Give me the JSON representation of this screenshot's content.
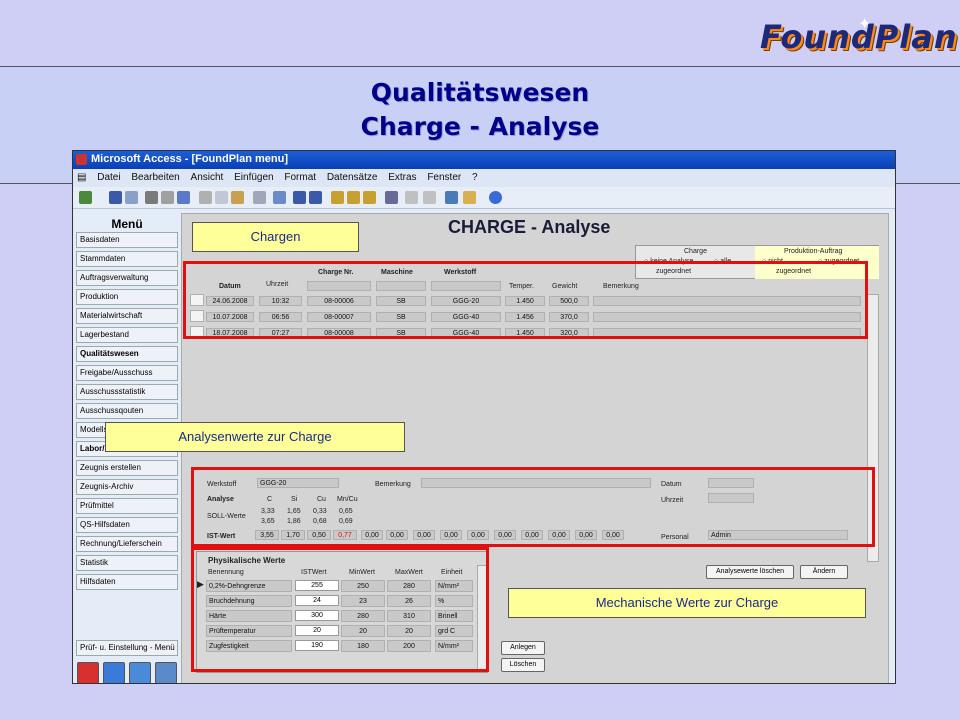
{
  "banner": {
    "line1": "Qualitätswesen",
    "line2": "Charge - Analyse"
  },
  "logo": {
    "text": "FoundPlan"
  },
  "window": {
    "title": "Microsoft Access - [FoundPlan menu]"
  },
  "menubar": [
    "Datei",
    "Bearbeiten",
    "Ansicht",
    "Einfügen",
    "Format",
    "Datensätze",
    "Extras",
    "Fenster",
    "?"
  ],
  "sidebar": {
    "heading": "Menü",
    "items": [
      "Basisdaten",
      "Stammdaten",
      "Auftragsverwaltung",
      "Produktion",
      "Materialwirtschaft",
      "Lagerbestand",
      "Qualitätswesen",
      "Freigabe/Ausschuss",
      "Ausschussstatistik",
      "Ausschussqouten",
      "Modellst",
      "Labor/",
      "Zeugnis erstellen",
      "Zeugnis-Archiv",
      "Prüfmittel",
      "QS-Hilfsdaten",
      "Rechnung/Lieferschein",
      "Statistik",
      "Hilfsdaten"
    ],
    "bottom_button": "Prüf- u. Einstellung - Menü"
  },
  "form": {
    "title": "CHARGE - Analyse"
  },
  "filter": {
    "charge_header": "Charge",
    "auftrag_header": "Produktion-Auftrag",
    "opt1": "keine Analyse",
    "opt2": "alle",
    "opt3": "nicht",
    "opt4": "zugeordnet",
    "zugeordnet1": "zugeordnet",
    "zugeordnet2": "zugeordnet"
  },
  "charges": {
    "headers": {
      "datum": "Datum",
      "uhrzeit": "Uhrzeit",
      "charge_nr": "Charge Nr.",
      "maschine": "Maschine",
      "werkstoff": "Werkstoff",
      "temper": "Temper.",
      "gewicht": "Gewicht",
      "bemerkung": "Bemerkung"
    },
    "rows": [
      {
        "datum": "24.06.2008",
        "uhrzeit": "10:32",
        "charge_nr": "08-00006",
        "maschine": "SB",
        "werkstoff": "GGG-20",
        "temper": "1.450",
        "gewicht": "500,0"
      },
      {
        "datum": "10.07.2008",
        "uhrzeit": "06:56",
        "charge_nr": "08-00007",
        "maschine": "SB",
        "werkstoff": "GGG-40",
        "temper": "1.456",
        "gewicht": "370,0"
      },
      {
        "datum": "18.07.2008",
        "uhrzeit": "07:27",
        "charge_nr": "08-00008",
        "maschine": "SB",
        "werkstoff": "GGG-40",
        "temper": "1.450",
        "gewicht": "320,0"
      }
    ]
  },
  "analysis": {
    "werkstoff_label": "Werkstoff",
    "werkstoff_value": "GGG-20",
    "bemerkung_label": "Bemerkung",
    "datum_label": "Datum",
    "uhrzeit_label": "Uhrzeit",
    "analyse_label": "Analyse",
    "elements": [
      "C",
      "Si",
      "Cu",
      "Mn/Cu"
    ],
    "soll_label": "SOLL-Werte",
    "soll_row1": [
      "3,33",
      "1,65",
      "0,33",
      "0,65"
    ],
    "soll_row2": [
      "3,65",
      "1,86",
      "0,68",
      "0,69"
    ],
    "ist_label": "IST-Wert",
    "ist_values": [
      "3,55",
      "1,70",
      "0,50",
      "0,77",
      "0,00",
      "0,00",
      "0,00",
      "0,00",
      "0,00",
      "0,00",
      "0,00",
      "0,00",
      "0,00",
      "0,00"
    ],
    "personal_label": "Personal",
    "personal_value": "Admin",
    "red_value_color": "#e01010"
  },
  "physical": {
    "title": "Physikalische Werte",
    "headers": {
      "benennung": "Benennung",
      "ist": "ISTWert",
      "min": "MinWert",
      "max": "MaxWert",
      "einheit": "Einheit"
    },
    "rows": [
      {
        "benennung": "0,2%-Dehngrenze",
        "ist": "255",
        "min": "250",
        "max": "280",
        "einheit": "N/mm²"
      },
      {
        "benennung": "Bruchdehnung",
        "ist": "24",
        "min": "23",
        "max": "26",
        "einheit": "%"
      },
      {
        "benennung": "Härte",
        "ist": "300",
        "min": "280",
        "max": "310",
        "einheit": "Brinell"
      },
      {
        "benennung": "Prüftemperatur",
        "ist": "20",
        "min": "20",
        "max": "20",
        "einheit": "grd C"
      },
      {
        "benennung": "Zugfestigkeit",
        "ist": "190",
        "min": "180",
        "max": "200",
        "einheit": "N/mm²"
      }
    ]
  },
  "buttons": {
    "analysewerte_loeschen": "Analysewerte löschen",
    "aendern": "Ändern",
    "anlegen": "Anlegen",
    "loeschen": "Löschen"
  },
  "callouts": {
    "chargen": "Chargen",
    "analysenwerte": "Analysenwerte zur Charge",
    "mechanische": "Mechanische Werte zur Charge"
  },
  "colors": {
    "highlight": "#e01010",
    "callout_bg": "#ffff99",
    "title_text": "#00008b"
  }
}
